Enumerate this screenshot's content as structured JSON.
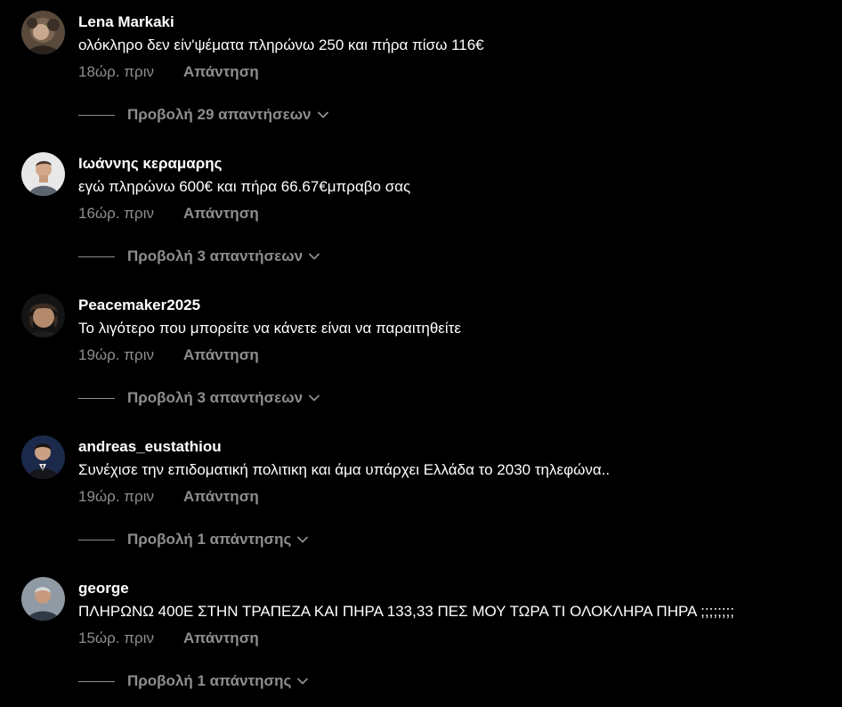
{
  "comments": [
    {
      "username": "Lena Markaki",
      "text": "ολόκληρο δεν είν'ψέματα πληρώνω 250 και πήρα πίσω 116€",
      "time": "18ώρ. πριν",
      "reply_label": "Απάντηση",
      "view_replies_label": "Προβολή 29 απαντήσεων"
    },
    {
      "username": "Ιωάννης κεραμαρης",
      "text": "εγώ πληρώνω 600€ και πήρα 66.67€μπραβο σας",
      "time": "16ώρ. πριν",
      "reply_label": "Απάντηση",
      "view_replies_label": "Προβολή 3 απαντήσεων"
    },
    {
      "username": "Peacemaker2025",
      "text": "Το λιγότερο που μπορείτε να κάνετε είναι να παραιτηθείτε",
      "time": "19ώρ. πριν",
      "reply_label": "Απάντηση",
      "view_replies_label": "Προβολή 3 απαντήσεων"
    },
    {
      "username": "andreas_eustathiou",
      "text": "Συνέχισε την επιδοματική πολιτικη και άμα υπάρχει Ελλάδα το 2030 τηλεφώνα..",
      "time": "19ώρ. πριν",
      "reply_label": "Απάντηση",
      "view_replies_label": "Προβολή 1 απάντησης"
    },
    {
      "username": "george",
      "text": "ΠΛΗΡΩΝΩ 400Ε ΣΤΗΝ ΤΡΑΠΕΖΑ ΚΑΙ ΠΗΡΑ 133,33 ΠΕΣ ΜΟΥ ΤΩΡΑ ΤΙ ΟΛΟΚΛΗΡΑ ΠΗΡΑ ;;;;;;;;",
      "time": "15ώρ. πριν",
      "reply_label": "Απάντηση",
      "view_replies_label": "Προβολή 1 απάντησης"
    }
  ],
  "colors": {
    "background": "#000000",
    "primary_text": "#ffffff",
    "secondary_text": "#8e8e8e"
  },
  "icons": {
    "expand": "chevron-down-icon"
  }
}
